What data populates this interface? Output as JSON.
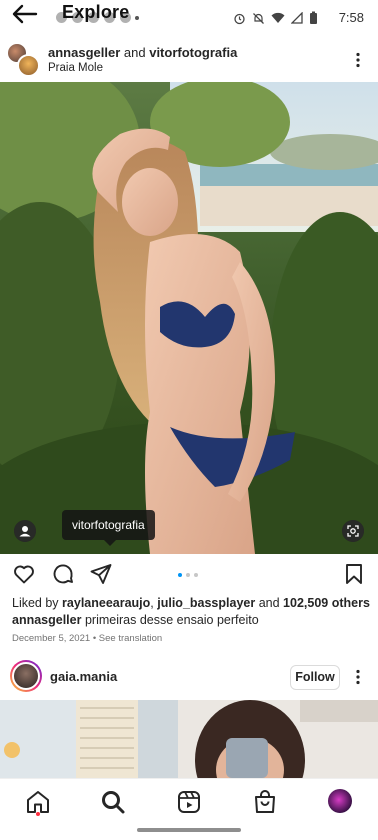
{
  "header": {
    "title": "Explore",
    "time": "7:58"
  },
  "post": {
    "user1": "annasgeller",
    "conjunction": "and",
    "user2": "vitorfotografia",
    "location": "Praia Mole",
    "tagged_user": "vitorfotografia",
    "liked_by_prefix": "Liked by",
    "liked_by_user1": "raylaneearaujo",
    "liked_by_user2": "julio_bassplayer",
    "liked_by_and": "and",
    "liked_by_others": "102,509 others",
    "caption_user": "annasgeller",
    "caption_text": "primeiras desse ensaio perfeito",
    "date": "December 5, 2021",
    "see_translation": "See translation",
    "carousel": {
      "index": 1,
      "count": 3
    }
  },
  "post2": {
    "username": "gaia.mania",
    "follow_label": "Follow"
  },
  "colors": {
    "accent_blue": "#0095f6",
    "notification_red": "#ff3040",
    "text": "#262626"
  },
  "icons": [
    "back-arrow-icon",
    "alarm-icon",
    "mute-icon",
    "wifi-icon",
    "signal-icon",
    "battery-icon",
    "more-vertical-icon",
    "tag-user-icon",
    "visual-search-icon",
    "heart-icon",
    "comment-icon",
    "share-icon",
    "bookmark-icon",
    "home-icon",
    "search-icon",
    "reels-icon",
    "shop-icon"
  ]
}
